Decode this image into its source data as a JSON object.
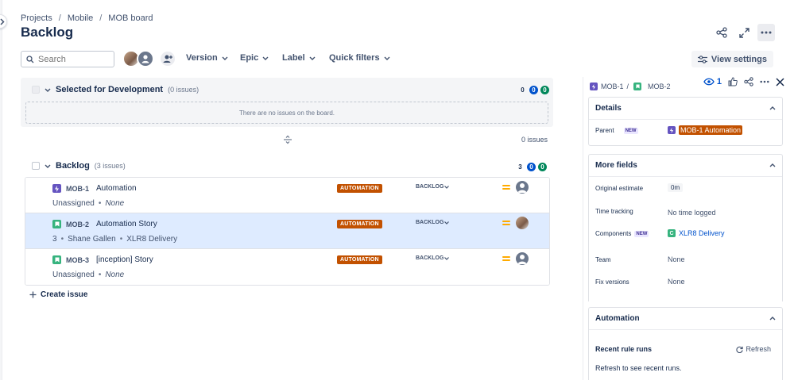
{
  "breadcrumb": [
    "Projects",
    "Mobile",
    "MOB board"
  ],
  "page_title": "Backlog",
  "toolbar": {
    "search_placeholder": "Search",
    "filters": [
      "Version",
      "Epic",
      "Label",
      "Quick filters"
    ],
    "view_settings": "View settings"
  },
  "sprint": {
    "title": "Selected for Development",
    "count": "(0 issues)",
    "counts": [
      "0",
      "0",
      "0"
    ],
    "empty_text": "There are no issues on the board.",
    "footer_count": "0 issues"
  },
  "backlog": {
    "title": "Backlog",
    "count": "(3 issues)",
    "counts": [
      "3",
      "0",
      "0"
    ],
    "issues": [
      {
        "key": "MOB-1",
        "type": "epic",
        "summary": "Automation",
        "meta_prefix": "Unassigned",
        "meta_value": "None",
        "label": "AUTOMATION",
        "status": "BACKLOG",
        "assignee": "generic"
      },
      {
        "key": "MOB-2",
        "type": "story",
        "summary": "Automation Story",
        "meta_prefix": "3",
        "meta_person": "Shane Gallen",
        "meta_value": "XLR8 Delivery",
        "label": "AUTOMATION",
        "status": "BACKLOG",
        "assignee": "photo"
      },
      {
        "key": "MOB-3",
        "type": "story",
        "summary": "[inception] Story",
        "meta_prefix": "Unassigned",
        "meta_value": "None",
        "label": "AUTOMATION",
        "status": "BACKLOG",
        "assignee": "generic"
      }
    ],
    "create_issue": "Create issue"
  },
  "panel": {
    "parent_key": "MOB-1",
    "sep": "/",
    "issue_key": "MOB-2",
    "watch_count": "1",
    "details": {
      "title": "Details",
      "parent_label": "Parent",
      "new_badge": "NEW",
      "parent_value": "MOB-1 Automation"
    },
    "more_fields": {
      "title": "More fields",
      "original_estimate_label": "Original estimate",
      "original_estimate_value": "0m",
      "time_tracking_label": "Time tracking",
      "time_tracking_value": "No time logged",
      "components_label": "Components",
      "components_badge": "NEW",
      "components_value": "XLR8 Delivery",
      "team_label": "Team",
      "team_value": "None",
      "fix_versions_label": "Fix versions",
      "fix_versions_value": "None"
    },
    "automation": {
      "title": "Automation",
      "recent_label": "Recent rule runs",
      "refresh": "Refresh",
      "hint": "Refresh to see recent runs."
    }
  },
  "colors": {
    "label_orange": "#c25100",
    "epic_purple": "#6554c0",
    "story_green": "#36b37e",
    "selected_row": "#deebff",
    "link_blue": "#0052cc",
    "priority_yellow": "#ffab00"
  }
}
